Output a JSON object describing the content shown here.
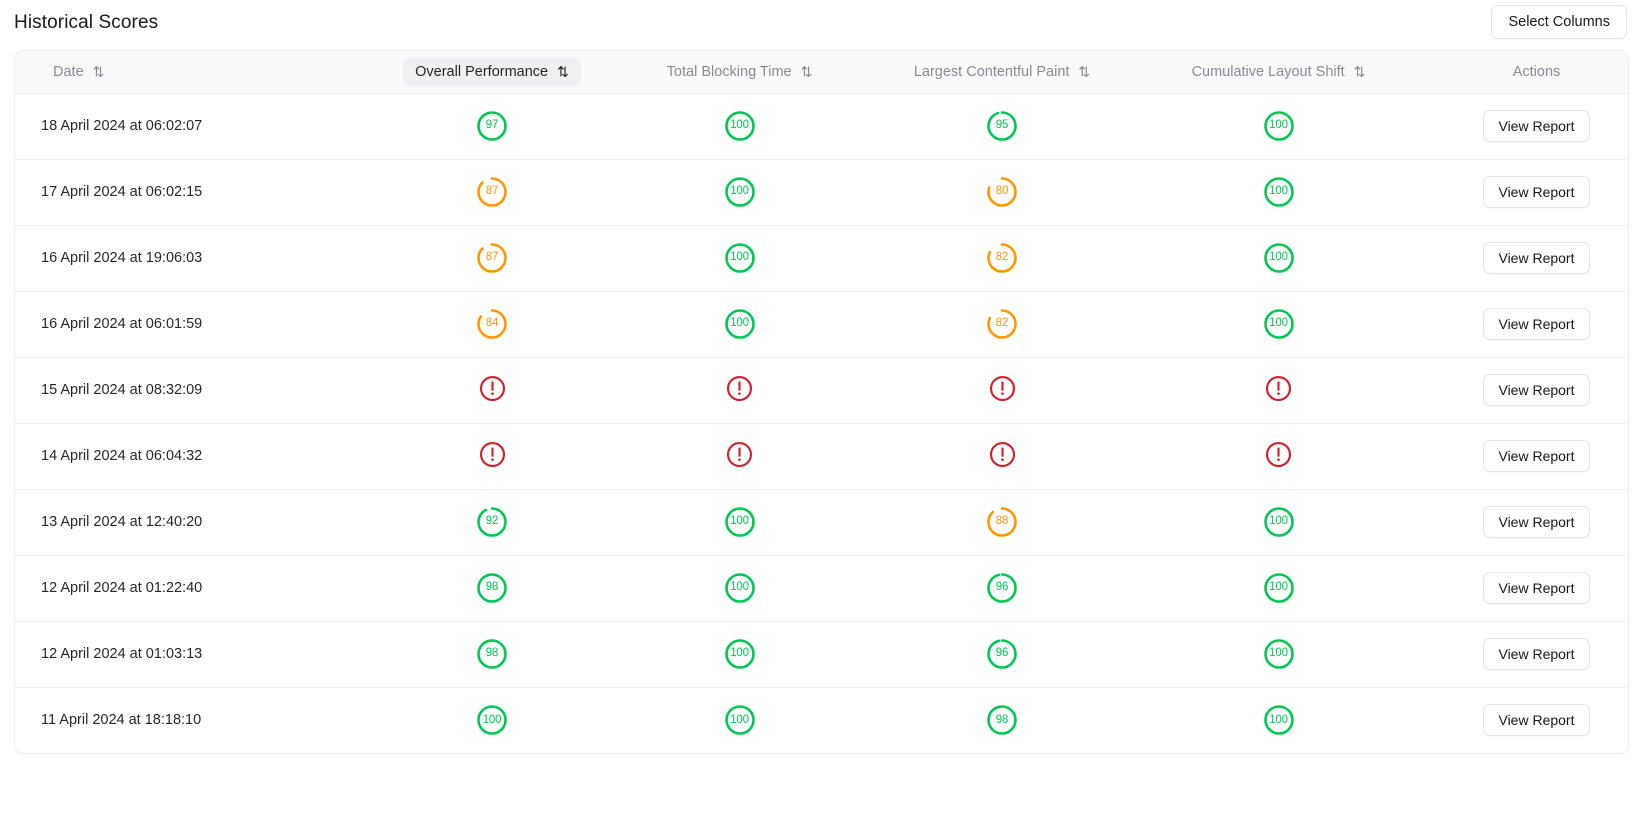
{
  "header": {
    "title": "Historical Scores",
    "select_columns_label": "Select Columns"
  },
  "colors": {
    "good": "#00c853",
    "average": "#ff9800",
    "error": "#d32029",
    "header_text": "#8a8a93",
    "header_active_text": "#27272a",
    "header_active_bg": "#f0f0f2",
    "row_text": "#27272a",
    "border": "#ededf0"
  },
  "table": {
    "sort_icon": "⇅",
    "columns": [
      {
        "key": "date",
        "label": "Date",
        "sortable": true,
        "active": false,
        "align": "left"
      },
      {
        "key": "overall",
        "label": "Overall Performance",
        "sortable": true,
        "active": true,
        "align": "center"
      },
      {
        "key": "tbt",
        "label": "Total Blocking Time",
        "sortable": true,
        "active": false,
        "align": "center"
      },
      {
        "key": "lcp",
        "label": "Largest Contentful Paint",
        "sortable": true,
        "active": false,
        "align": "center"
      },
      {
        "key": "cls",
        "label": "Cumulative Layout Shift",
        "sortable": true,
        "active": false,
        "align": "center"
      },
      {
        "key": "actions",
        "label": "Actions",
        "sortable": false,
        "active": false,
        "align": "center"
      }
    ],
    "action_label": "View Report",
    "error_glyph": "!",
    "rows": [
      {
        "date": "18 April 2024 at 06:02:07",
        "overall": 97,
        "tbt": 100,
        "lcp": 95,
        "cls": 100
      },
      {
        "date": "17 April 2024 at 06:02:15",
        "overall": 87,
        "tbt": 100,
        "lcp": 80,
        "cls": 100
      },
      {
        "date": "16 April 2024 at 19:06:03",
        "overall": 87,
        "tbt": 100,
        "lcp": 82,
        "cls": 100
      },
      {
        "date": "16 April 2024 at 06:01:59",
        "overall": 84,
        "tbt": 100,
        "lcp": 82,
        "cls": 100
      },
      {
        "date": "15 April 2024 at 08:32:09",
        "overall": null,
        "tbt": null,
        "lcp": null,
        "cls": null
      },
      {
        "date": "14 April 2024 at 06:04:32",
        "overall": null,
        "tbt": null,
        "lcp": null,
        "cls": null
      },
      {
        "date": "13 April 2024 at 12:40:20",
        "overall": 92,
        "tbt": 100,
        "lcp": 88,
        "cls": 100
      },
      {
        "date": "12 April 2024 at 01:22:40",
        "overall": 98,
        "tbt": 100,
        "lcp": 96,
        "cls": 100
      },
      {
        "date": "12 April 2024 at 01:03:13",
        "overall": 98,
        "tbt": 100,
        "lcp": 96,
        "cls": 100
      },
      {
        "date": "11 April 2024 at 18:18:10",
        "overall": 100,
        "tbt": 100,
        "lcp": 98,
        "cls": 100
      }
    ]
  }
}
